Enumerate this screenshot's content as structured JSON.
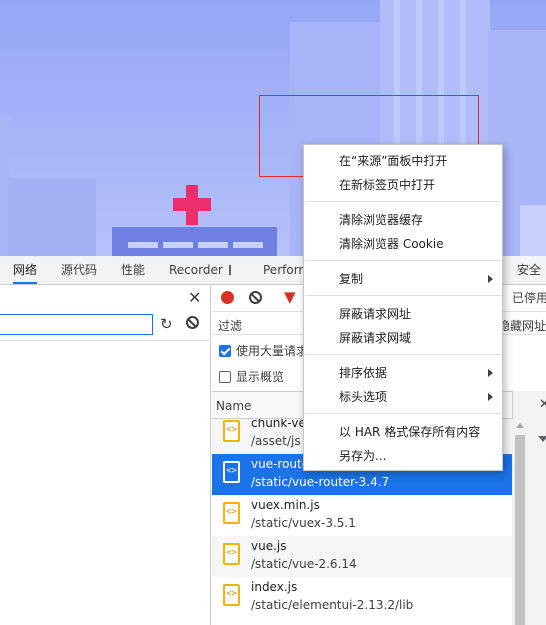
{
  "devtools_tabs": [
    {
      "label": "网络",
      "active": true
    },
    {
      "label": "源代码",
      "active": false
    },
    {
      "label": "性能",
      "active": false
    },
    {
      "label": "Recorder",
      "active": false,
      "icon": "flask-icon"
    },
    {
      "label": "Perform",
      "active": false
    },
    {
      "label": "安全",
      "active": false
    }
  ],
  "toolbar": {
    "disable_label": "已停用",
    "filter_placeholder": "过滤",
    "filter_right": "隐藏网址 会"
  },
  "options": {
    "large_rows_label": "使用大量请求",
    "large_rows_checked": true,
    "overview_label": "显示概览",
    "overview_checked": false
  },
  "table": {
    "name_header": "Name"
  },
  "files": [
    {
      "name": "chunk-ven",
      "path": "/asset/js",
      "selected": false
    },
    {
      "name": "vue-router.min.js",
      "path": "/static/vue-router-3.4.7",
      "selected": true
    },
    {
      "name": "vuex.min.js",
      "path": "/static/vuex-3.5.1",
      "selected": false
    },
    {
      "name": "vue.js",
      "path": "/static/vue-2.6.14",
      "selected": false
    },
    {
      "name": "index.js",
      "path": "/static/elementui-2.13.2/lib",
      "selected": false
    }
  ],
  "file_icon_glyph": "<>",
  "context_menu": {
    "open_in_sources": "在“来源”面板中打开",
    "open_new_tab": "在新标签页中打开",
    "clear_cache": "清除浏览器缓存",
    "clear_cookie": "清除浏览器 Cookie",
    "copy": "复制",
    "block_url": "屏蔽请求网址",
    "block_domain": "屏蔽请求网域",
    "sort_by": "排序依据",
    "header_options": "标头选项",
    "save_har": "以 HAR 格式保存所有内容",
    "save_as": "另存为..."
  },
  "colors": {
    "accent": "#1a73e8",
    "record": "#d93025",
    "highlight_box": "#e0282e",
    "cross": "#ec2f6a"
  }
}
